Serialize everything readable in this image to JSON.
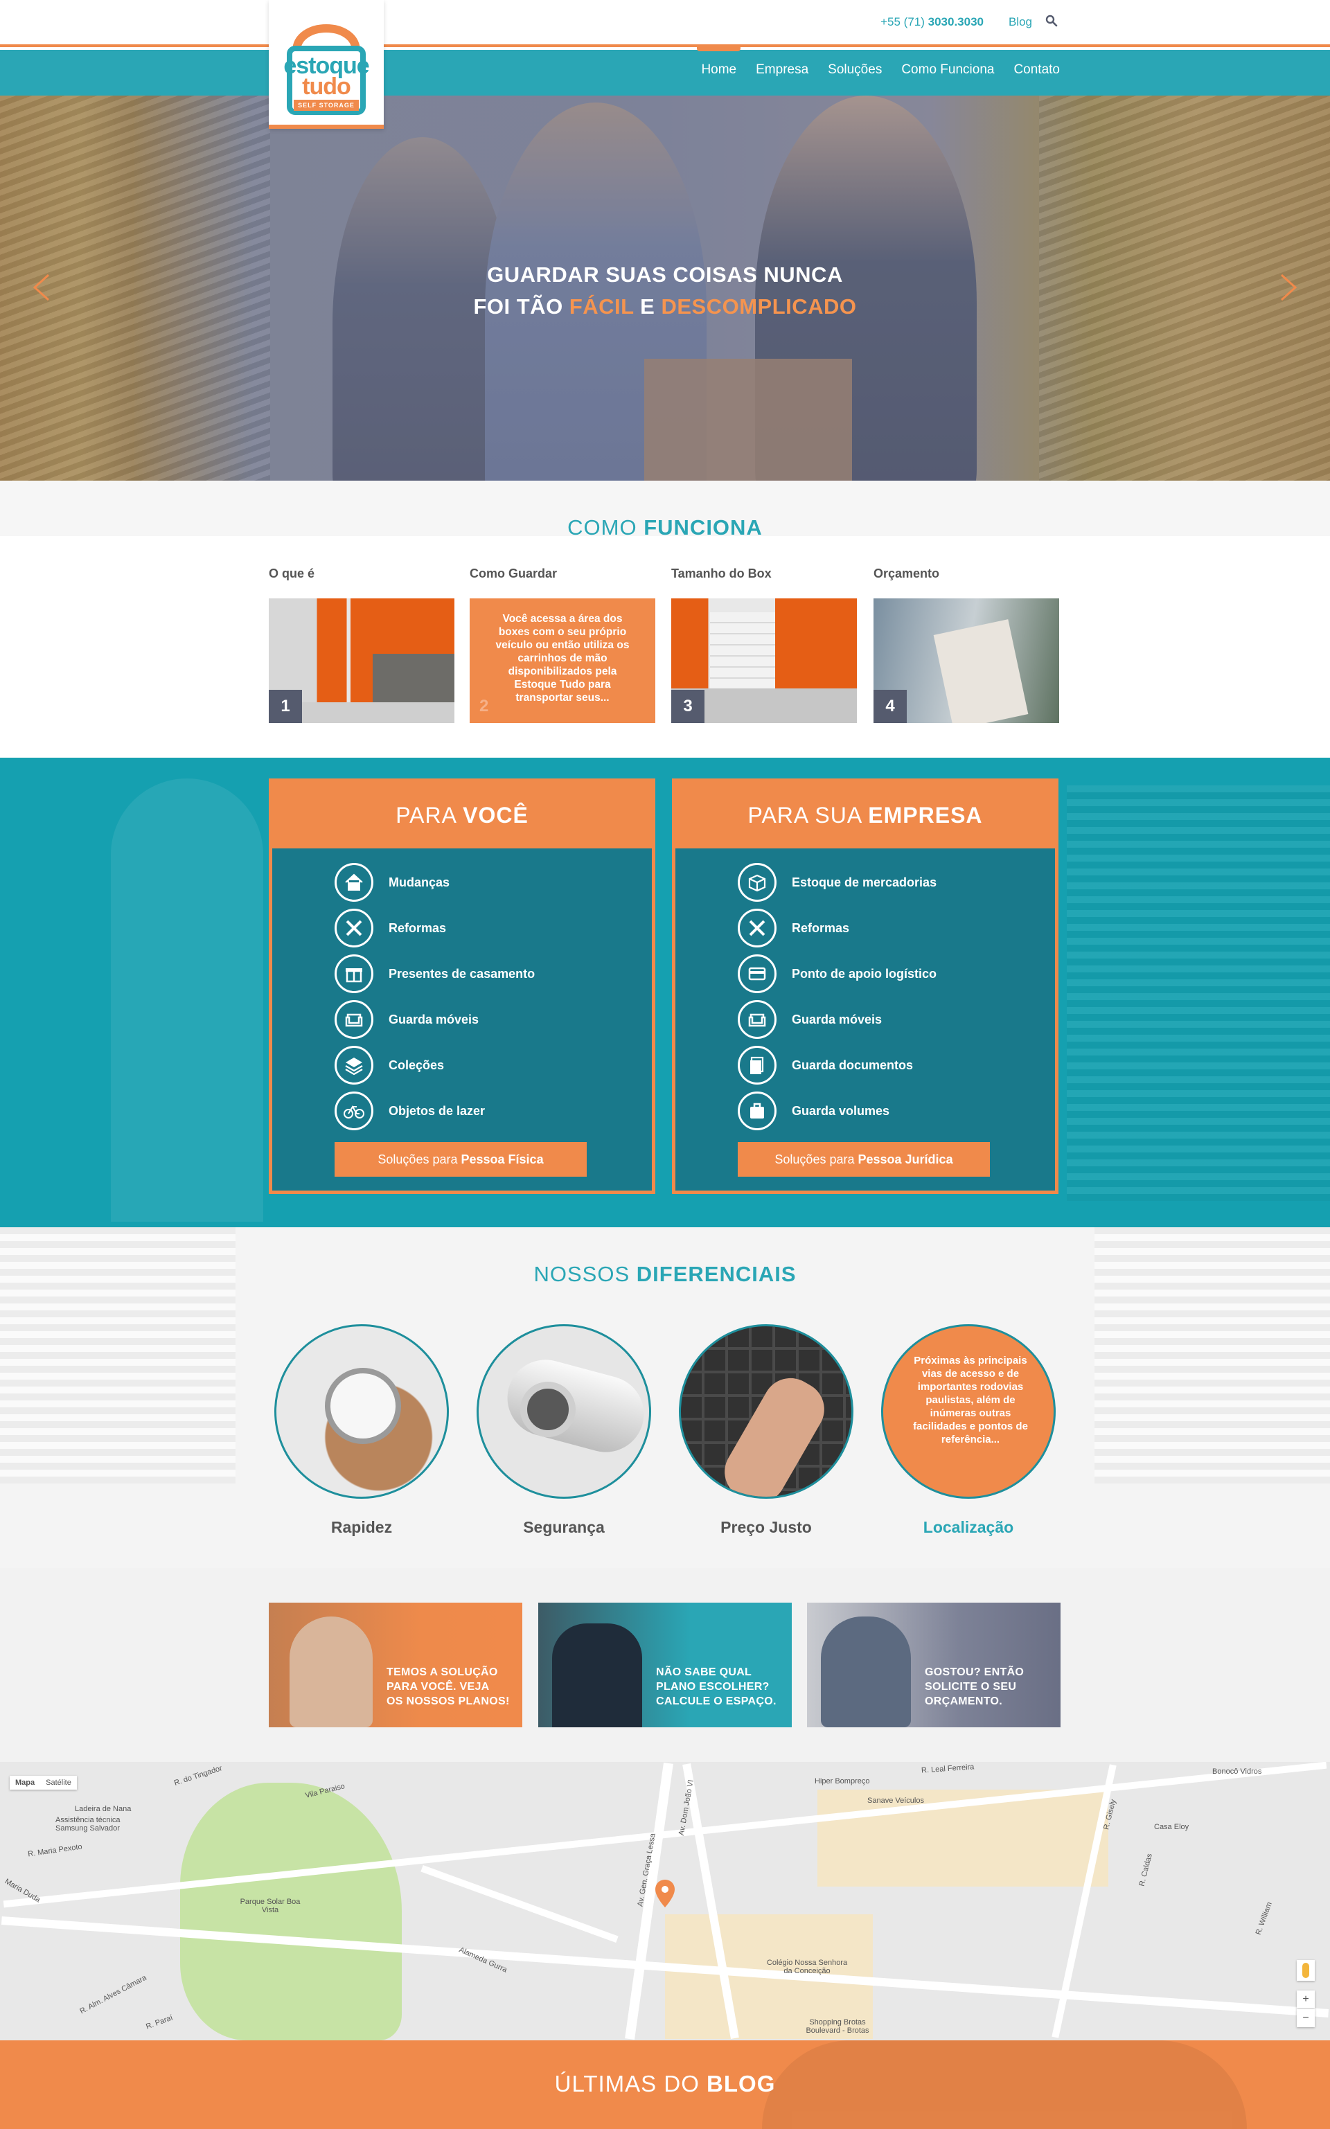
{
  "brand": {
    "logo_line1": "estoque",
    "logo_line2": "tudo",
    "logo_tag": "SELF STORAGE",
    "colors": {
      "orange": "#f08a4b",
      "teal": "#2aa6b5",
      "dark": "#555b6e"
    }
  },
  "topbar": {
    "phone_prefix": "+55 (71)",
    "phone_number": "3030.3030",
    "blog_label": "Blog",
    "search_icon": "search-icon"
  },
  "nav": {
    "items": [
      "Home",
      "Empresa",
      "Soluções",
      "Como Funciona",
      "Contato"
    ],
    "active": "Home"
  },
  "hero": {
    "line1": "GUARDAR SUAS COISAS NUNCA",
    "line2_a": "FOI TÃO",
    "line2_b": "FÁCIL",
    "line2_c": "E",
    "line2_d": "DESCOMPLICADO",
    "prev_icon": "chevron-left-icon",
    "next_icon": "chevron-right-icon"
  },
  "como": {
    "title_light": "COMO",
    "title_bold": "FUNCIONA",
    "steps": [
      {
        "label": "O que é",
        "num": "1"
      },
      {
        "label": "Como Guardar",
        "num": "2",
        "text": "Você acessa a área dos boxes com o seu próprio veículo ou então utiliza os carrinhos de mão disponibilizados pela Estoque Tudo para transportar seus..."
      },
      {
        "label": "Tamanho do Box",
        "num": "3"
      },
      {
        "label": "Orçamento",
        "num": "4"
      }
    ]
  },
  "solucoes": {
    "voce": {
      "title_light": "PARA",
      "title_bold": "VOCÊ",
      "items": [
        "Mudanças",
        "Reformas",
        "Presentes de casamento",
        "Guarda móveis",
        "Coleções",
        "Objetos de lazer"
      ],
      "icons": [
        "house-icon",
        "tools-icon",
        "gift-icon",
        "armchair-icon",
        "layers-icon",
        "bicycle-icon"
      ],
      "btn_light": "Soluções para",
      "btn_bold": "Pessoa Física"
    },
    "empresa": {
      "title_light": "PARA SUA",
      "title_bold": "EMPRESA",
      "items": [
        "Estoque de mercadorias",
        "Reformas",
        "Ponto de apoio logístico",
        "Guarda móveis",
        "Guarda documentos",
        "Guarda volumes"
      ],
      "icons": [
        "box-icon",
        "tools-icon",
        "card-icon",
        "armchair-icon",
        "documents-icon",
        "suitcase-icon"
      ],
      "btn_light": "Soluções para",
      "btn_bold": "Pessoa Jurídica"
    }
  },
  "diferenciais": {
    "title_light": "NOSSOS",
    "title_bold": "DIFERENCIAIS",
    "items": [
      {
        "label": "Rapidez"
      },
      {
        "label": "Segurança"
      },
      {
        "label": "Preço Justo"
      },
      {
        "label": "Localização",
        "text": "Próximas às principais vias de acesso e de importantes rodovias paulistas, além de inúmeras outras facilidades e pontos de referência..."
      }
    ]
  },
  "promo": [
    {
      "line1": "TEMOS A SOLUÇÃO",
      "line2": "PARA VOCÊ. VEJA",
      "line3": "OS NOSSOS PLANOS!"
    },
    {
      "line1": "NÃO SABE QUAL",
      "line2": "PLANO ESCOLHER?",
      "line3": "CALCULE O ESPAÇO."
    },
    {
      "line1": "GOSTOU? ENTÃO",
      "line2": "SOLICITE O SEU",
      "line3": "ORÇAMENTO."
    }
  ],
  "map": {
    "type_map": "Mapa",
    "type_sat": "Satélite",
    "zoom_in": "+",
    "zoom_out": "−",
    "labels": [
      "R. do Tingador",
      "Ladeira de Nana",
      "Assistência técnica Samsung Salvador",
      "R. Maria Pexoto",
      "Maria Duda",
      "Parque Solar Boa Vista",
      "Vila Paraiso",
      "R. Alm. Alves Câmara",
      "R. Paraí",
      "Alameda Gurra",
      "Av. Gen. Graça Lessa",
      "Av. Dom João VI",
      "Hiper Bompreço",
      "Sanave Veículos",
      "Colégio Nossa Senhora da Conceição",
      "Shopping Brotas Boulevard - Brotas",
      "Casa Eloy",
      "Bonocô Vidros",
      "R. Leal Ferreira",
      "R. Gisely",
      "R. Caldas",
      "R. William"
    ]
  },
  "blog": {
    "title_light": "ÚLTIMAS DO",
    "title_bold": "BLOG"
  }
}
